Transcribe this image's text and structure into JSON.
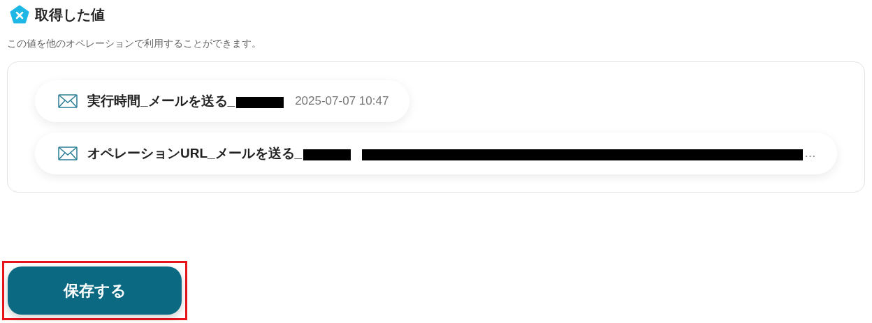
{
  "section": {
    "title": "取得した値",
    "description": "この値を他のオペレーションで利用することができます。"
  },
  "values": [
    {
      "label": "実行時間_メールを送る_",
      "label_redacted": true,
      "value": "2025-07-07 10:47",
      "value_redacted": false
    },
    {
      "label": "オペレーションURL_メールを送る_",
      "label_redacted": true,
      "value": "…",
      "value_redacted": true
    }
  ],
  "save_button": {
    "label": "保存する",
    "highlighted": true
  }
}
